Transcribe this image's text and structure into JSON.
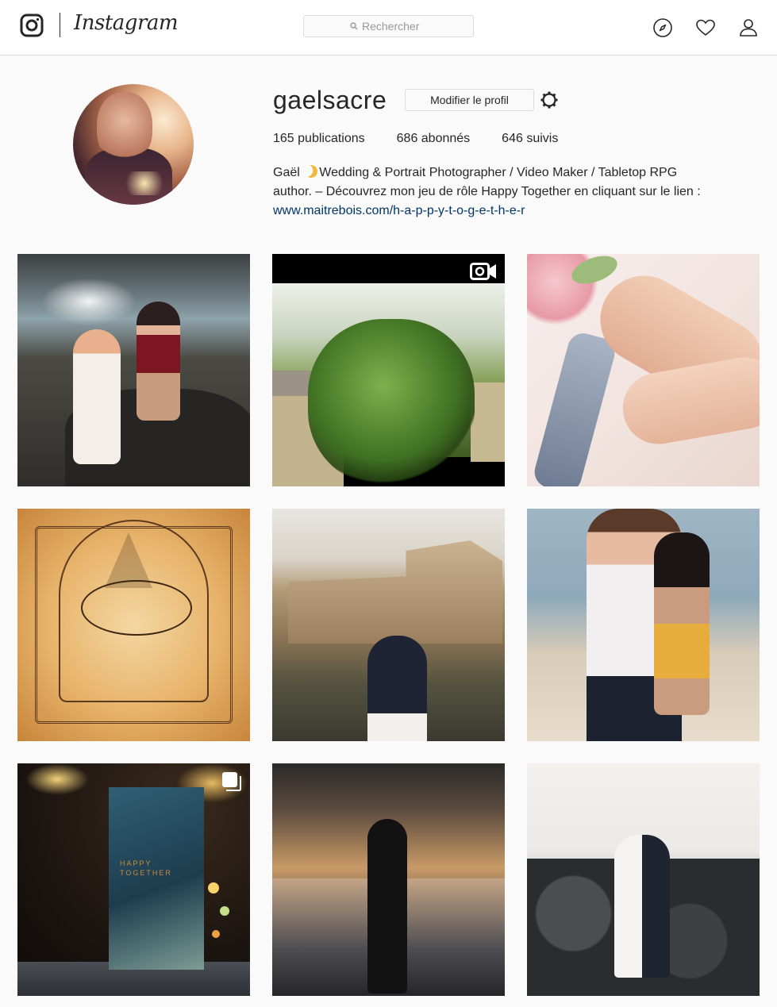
{
  "nav": {
    "logo_text": "Instagram",
    "search_placeholder": "Rechercher",
    "icons": [
      "camera-logo-icon",
      "explore-compass-icon",
      "heart-icon",
      "profile-person-icon"
    ]
  },
  "profile": {
    "username": "gaelsacre",
    "edit_button": "Modifier le profil",
    "stats": {
      "publications": "165 publications",
      "followers": "686 abonnés",
      "following": "646 suivis"
    },
    "bio": {
      "name": "Gaël",
      "line1": "Wedding & Portrait Photographer / Video Maker / Tabletop RPG",
      "line2": "author. – Découvrez mon jeu de rôle Happy Together en cliquant sur le lien :",
      "link": "www.maitrebois.com/h-a-p-p-y-t-o-g-e-t-h-e-r"
    }
  },
  "grid": {
    "posts": [
      {
        "subject": "two women on rocks by the sea"
      },
      {
        "subject": "tree and house",
        "badge": "video-icon"
      },
      {
        "subject": "hands with wedding rings"
      },
      {
        "subject": "engraved illustration with swan and sail"
      },
      {
        "subject": "couple kissing in front of castle ruins"
      },
      {
        "subject": "couple hugging on beach"
      },
      {
        "subject": "Happy Together book with bokeh lights",
        "badge": "carousel-icon",
        "book_title": "HAPPY TOGETHER"
      },
      {
        "subject": "silhouette with windswept hair at sunset"
      },
      {
        "subject": "wedding couple on seaside rocks"
      }
    ]
  },
  "colors": {
    "link": "#003569",
    "border": "#dbdbdb",
    "background": "#fafafa",
    "moon": "#f0b93a"
  }
}
